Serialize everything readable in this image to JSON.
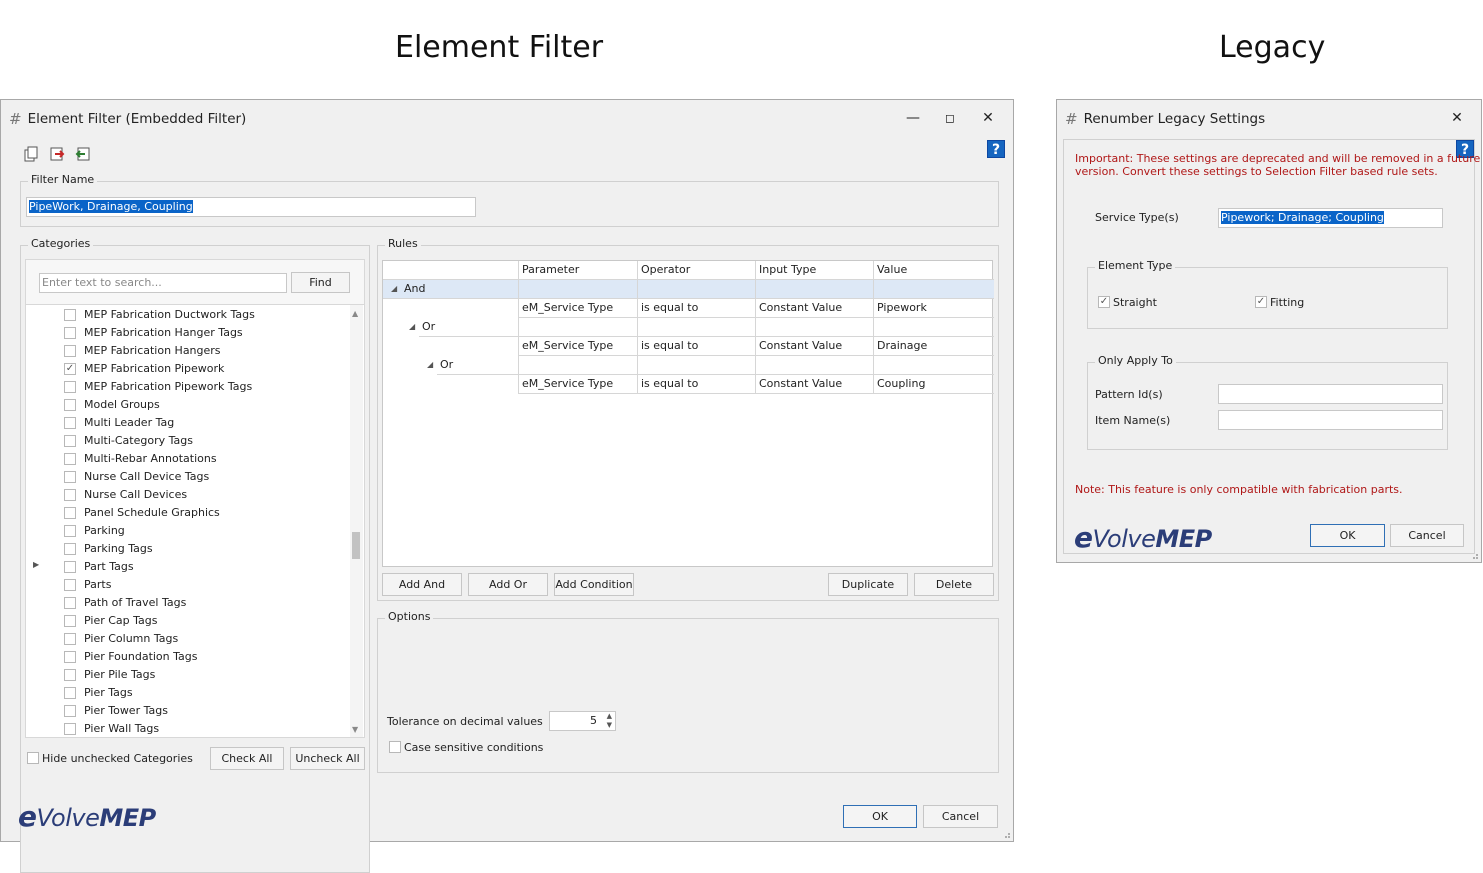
{
  "headings": {
    "left": "Element Filter",
    "right": "Legacy"
  },
  "filter_dialog": {
    "title": "Element Filter (Embedded Filter)",
    "toolbar_icons": [
      "new-document-icon",
      "export-icon",
      "import-icon"
    ],
    "help_label": "?",
    "filter_name": {
      "label": "Filter Name",
      "value": "PipeWork, Drainage, Coupling"
    },
    "categories": {
      "label": "Categories",
      "search_placeholder": "Enter text to search...",
      "find_label": "Find",
      "items": [
        {
          "label": "MEP Fabrication Ductwork Tags",
          "checked": false
        },
        {
          "label": "MEP Fabrication Hanger Tags",
          "checked": false
        },
        {
          "label": "MEP Fabrication Hangers",
          "checked": false
        },
        {
          "label": "MEP Fabrication Pipework",
          "checked": true
        },
        {
          "label": "MEP Fabrication Pipework Tags",
          "checked": false
        },
        {
          "label": "Model Groups",
          "checked": false
        },
        {
          "label": "Multi Leader Tag",
          "checked": false
        },
        {
          "label": "Multi-Category Tags",
          "checked": false
        },
        {
          "label": "Multi-Rebar Annotations",
          "checked": false
        },
        {
          "label": "Nurse Call Device Tags",
          "checked": false
        },
        {
          "label": "Nurse Call Devices",
          "checked": false
        },
        {
          "label": "Panel Schedule Graphics",
          "checked": false
        },
        {
          "label": "Parking",
          "checked": false
        },
        {
          "label": "Parking Tags",
          "checked": false
        },
        {
          "label": "Part Tags",
          "checked": false
        },
        {
          "label": "Parts",
          "checked": false
        },
        {
          "label": "Path of Travel Tags",
          "checked": false
        },
        {
          "label": "Pier Cap Tags",
          "checked": false
        },
        {
          "label": "Pier Column Tags",
          "checked": false
        },
        {
          "label": "Pier Foundation Tags",
          "checked": false
        },
        {
          "label": "Pier Pile Tags",
          "checked": false
        },
        {
          "label": "Pier Tags",
          "checked": false
        },
        {
          "label": "Pier Tower Tags",
          "checked": false
        },
        {
          "label": "Pier Wall Tags",
          "checked": false
        }
      ],
      "hide_unchecked_label": "Hide unchecked Categories",
      "check_all_label": "Check All",
      "uncheck_all_label": "Uncheck All"
    },
    "rules": {
      "label": "Rules",
      "columns": [
        "Parameter",
        "Operator",
        "Input Type",
        "Value"
      ],
      "groups": [
        "And",
        "Or",
        "Or"
      ],
      "conditions": [
        {
          "parameter": "eM_Service Type",
          "operator": "is equal to",
          "input_type": "Constant Value",
          "value": "Pipework"
        },
        {
          "parameter": "eM_Service Type",
          "operator": "is equal to",
          "input_type": "Constant Value",
          "value": "Drainage"
        },
        {
          "parameter": "eM_Service Type",
          "operator": "is equal to",
          "input_type": "Constant Value",
          "value": "Coupling"
        }
      ],
      "add_and_label": "Add And",
      "add_or_label": "Add Or",
      "add_condition_label": "Add Condition",
      "duplicate_label": "Duplicate",
      "delete_label": "Delete"
    },
    "options": {
      "label": "Options",
      "tolerance_label": "Tolerance on decimal values",
      "tolerance_value": "5",
      "case_sensitive_label": "Case sensitive conditions"
    },
    "logo": {
      "e": "e",
      "volve": "Volve",
      "mep": "MEP"
    },
    "ok_label": "OK",
    "cancel_label": "Cancel"
  },
  "legacy_dialog": {
    "title": "Renumber Legacy Settings",
    "help_label": "?",
    "important_line1": "Important: These settings are deprecated and will be removed in a future",
    "important_line2": "version. Convert these settings to Selection Filter based rule sets.",
    "service_types_label": "Service Type(s)",
    "service_types_value": "Pipework; Drainage; Coupling",
    "element_type": {
      "label": "Element Type",
      "straight_label": "Straight",
      "straight_checked": true,
      "fitting_label": "Fitting",
      "fitting_checked": true
    },
    "only_apply_to": {
      "label": "Only Apply To",
      "pattern_ids_label": "Pattern Id(s)",
      "pattern_ids_value": "",
      "item_names_label": "Item Name(s)",
      "item_names_value": ""
    },
    "note": "Note: This feature is only compatible with fabrication parts.",
    "logo": {
      "e": "e",
      "volve": "Volve",
      "mep": "MEP"
    },
    "ok_label": "OK",
    "cancel_label": "Cancel"
  },
  "colors": {
    "accent": "#0a64c8",
    "logo": "#2b3d78",
    "warning": "#b01818",
    "selected_row": "#dde8f6"
  }
}
